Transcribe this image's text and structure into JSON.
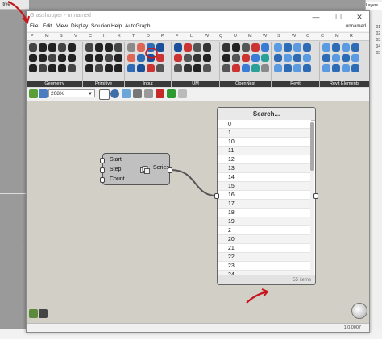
{
  "rhino": {
    "viewport_tab": "Perspective",
    "top_left_label": "itive",
    "right_panel_tab": "Layers",
    "right_panel_numbers": [
      "01",
      "02",
      "03",
      "04",
      "05"
    ]
  },
  "window": {
    "title": "Grasshopper - unnamed",
    "doc_name": "unnamed",
    "controls": {
      "minimize": "—",
      "maximize": "☐",
      "close": "✕"
    }
  },
  "menu": [
    "File",
    "Edit",
    "View",
    "Display",
    "Solution",
    "Help",
    "AutoGraph"
  ],
  "tab_letters": [
    "P",
    "M",
    "S",
    "V",
    "C",
    "I",
    "X",
    "T",
    "D",
    "P",
    "F",
    "L",
    "W",
    "Q",
    "U",
    "M",
    "W",
    "S",
    "W",
    "C",
    "C",
    "M",
    "R"
  ],
  "ribbon_panels": [
    "Geometry",
    "Primitive",
    "Input",
    "UM",
    "OpenNest",
    "Revit",
    "Revit Elements"
  ],
  "toolbar": {
    "zoom": "208%"
  },
  "series_component": {
    "inputs": [
      "Start",
      "Step",
      "Count"
    ],
    "output": "Series"
  },
  "panel": {
    "header": "Search...",
    "values": [
      "0",
      "1",
      "10",
      "11",
      "12",
      "13",
      "14",
      "15",
      "16",
      "17",
      "18",
      "19",
      "2",
      "20",
      "21",
      "22",
      "23",
      "24"
    ],
    "footer": "55 items"
  },
  "status": {
    "version": "1.0.0007"
  },
  "colors": {
    "annotation_red": "#c8161d",
    "canvas": "#d2cfc7",
    "ribbon_label": "#3a3a3a"
  }
}
